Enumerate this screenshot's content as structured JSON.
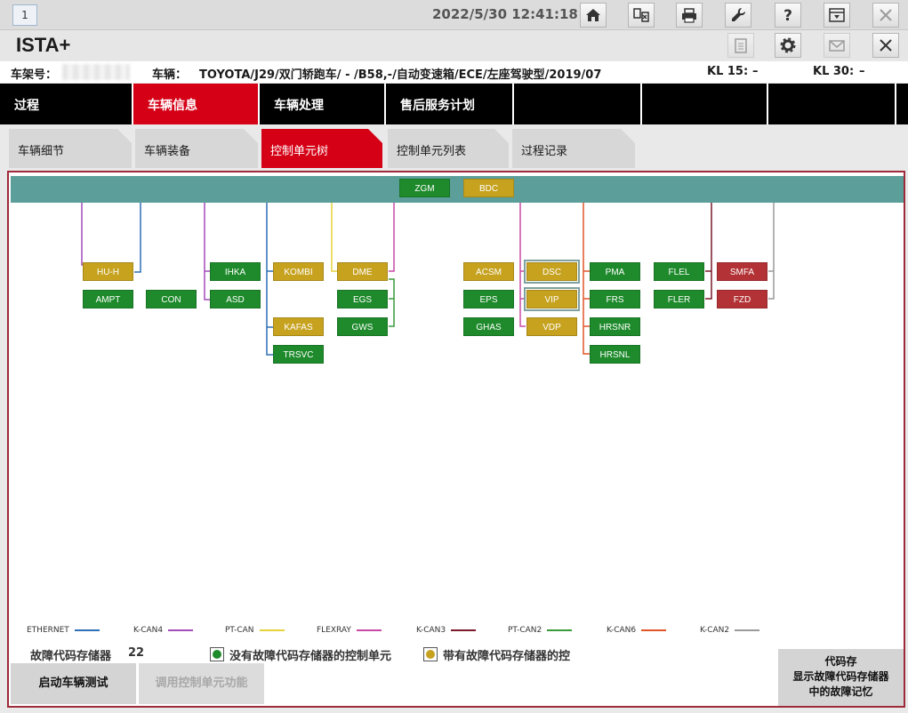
{
  "window": {
    "number": "1",
    "datetime": "2022/5/30 12:41:18",
    "app_title": "ISTA+"
  },
  "toolbar_icons": [
    "home-icon",
    "compare-icon",
    "print-icon",
    "wrench-icon",
    "help-icon",
    "dropdown-window-icon",
    "close-icon"
  ],
  "title_icons": [
    "clipboard-icon",
    "gear-icon",
    "mail-icon",
    "close-icon"
  ],
  "vehicle": {
    "vin_label": "车架号：",
    "vehicle_label": "车辆：",
    "vehicle_value": "TOYOTA/J29/双门轿跑车/ - /B58,-/自动变速箱/ECE/左座驾驶型/2019/07",
    "kl15_label": "KL 15:",
    "kl15_value": "–",
    "kl30_label": "KL 30:",
    "kl30_value": "–"
  },
  "main_tabs": [
    "过程",
    "车辆信息",
    "车辆处理",
    "售后服务计划",
    "",
    "",
    "",
    ""
  ],
  "sub_tabs": [
    "车辆细节",
    "车辆装备",
    "控制单元树",
    "控制单元列表",
    "过程记录"
  ],
  "ecus": {
    "ZGM": "ZGM",
    "BDC": "BDC",
    "HU-H": "HU-H",
    "AMPT": "AMPT",
    "CON": "CON",
    "IHKA": "IHKA",
    "ASD": "ASD",
    "KOMBI": "KOMBI",
    "KAFAS": "KAFAS",
    "TRSVC": "TRSVC",
    "DME": "DME",
    "EGS": "EGS",
    "GWS": "GWS",
    "ACSM": "ACSM",
    "EPS": "EPS",
    "GHAS": "GHAS",
    "DSC": "DSC",
    "VIP": "VIP",
    "VDP": "VDP",
    "PMA": "PMA",
    "FRS": "FRS",
    "HRSNR": "HRSNR",
    "HRSNL": "HRSNL",
    "FLEL": "FLEL",
    "FLER": "FLER",
    "SMFA": "SMFA",
    "FZD": "FZD"
  },
  "ecu_status_colors": {
    "ok": "#1e8a2c",
    "fault": "#c6a21f",
    "error": "#b23235"
  },
  "legend": [
    {
      "label": "ETHERNET",
      "color": "#2f6fb5"
    },
    {
      "label": "K-CAN4",
      "color": "#a44cb8"
    },
    {
      "label": "PT-CAN",
      "color": "#e6d23a"
    },
    {
      "label": "FLEXRAY",
      "color": "#c84aa6"
    },
    {
      "label": "K-CAN3",
      "color": "#7a1a2a"
    },
    {
      "label": "PT-CAN2",
      "color": "#3a9a3a"
    },
    {
      "label": "K-CAN6",
      "color": "#e0552a"
    },
    {
      "label": "K-CAN2",
      "color": "#9a9a9a"
    }
  ],
  "fault_memory": {
    "label": "故障代码存储器",
    "count": "22",
    "no_fault_label": "没有故障代码存储器的控制单元",
    "with_fault_label": "带有故障代码存储器的控"
  },
  "buttons": {
    "start_test": "启动车辆测试",
    "call_function": "调用控制单元功能",
    "show_fault_line1": "代码存",
    "show_fault_line2": "显示故障代码存储器",
    "show_fault_line3": "中的故障记忆"
  }
}
